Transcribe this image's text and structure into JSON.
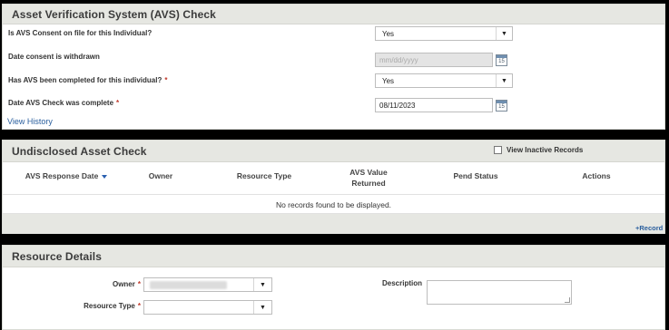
{
  "avs": {
    "title": "Asset Verification System (AVS) Check",
    "q1_label": "Is AVS Consent on file for this Individual?",
    "q1_value": "Yes",
    "q2_label": "Date consent is withdrawn",
    "q2_placeholder": "mm/dd/yyyy",
    "q3_label": "Has AVS been completed for this individual?",
    "q3_required": "*",
    "q3_value": "Yes",
    "q4_label": "Date AVS Check was complete",
    "q4_required": "*",
    "q4_value": "08/11/2023",
    "calendar_num": "15",
    "view_history": "View History"
  },
  "undisclosed": {
    "title": "Undisclosed Asset Check",
    "view_inactive": "View Inactive Records",
    "columns": [
      "AVS Response Date",
      "Owner",
      "Resource Type",
      "AVS Value Returned",
      "Pend Status",
      "Actions"
    ],
    "empty_message": "No records found to be displayed.",
    "add_record": "+Record"
  },
  "resource": {
    "title": "Resource Details",
    "owner_label": "Owner",
    "owner_required": "*",
    "resource_type_label": "Resource Type",
    "resource_type_required": "*",
    "description_label": "Description"
  },
  "icons": {
    "dropdown": "chevron-down-icon",
    "calendar": "calendar-icon",
    "sort": "sort-desc-icon"
  },
  "colors": {
    "header_bg": "#e6e7e2",
    "link": "#2a5f9e",
    "required": "#c0392b"
  }
}
